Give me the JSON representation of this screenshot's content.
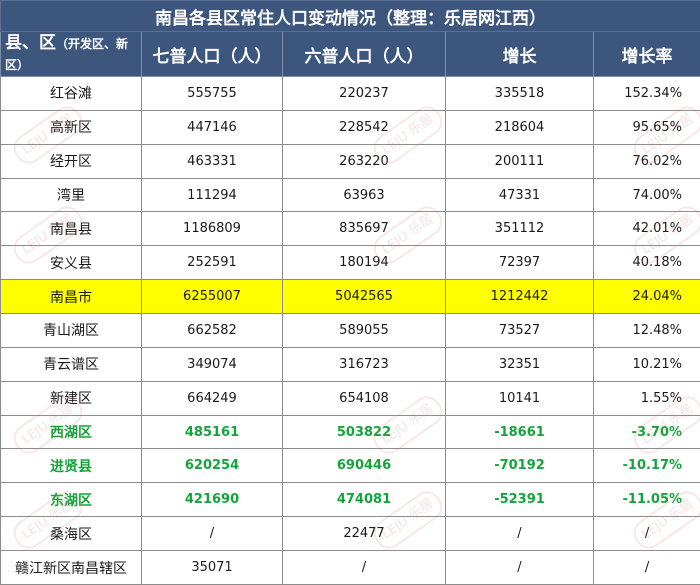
{
  "title": "南昌各县区常住人口变动情况（整理：乐居网江西）",
  "headers": {
    "district_main": "县、区",
    "district_note": "（开发区、新区）",
    "census7": "七普人口（人）",
    "census6": "六普人口（人）",
    "growth": "增长",
    "growth_rate": "增长率"
  },
  "watermark": "乐居",
  "colors": {
    "header_bg": "#3d567e",
    "highlight_bg": "#ffff00",
    "negative_text": "#15a43c"
  },
  "rows": [
    {
      "name": "红谷滩",
      "census7": "555755",
      "census6": "220237",
      "growth": "335518",
      "rate": "152.34%"
    },
    {
      "name": "高新区",
      "census7": "447146",
      "census6": "228542",
      "growth": "218604",
      "rate": "95.65%"
    },
    {
      "name": "经开区",
      "census7": "463331",
      "census6": "263220",
      "growth": "200111",
      "rate": "76.02%"
    },
    {
      "name": "湾里",
      "census7": "111294",
      "census6": "63963",
      "growth": "47331",
      "rate": "74.00%"
    },
    {
      "name": "南昌县",
      "census7": "1186809",
      "census6": "835697",
      "growth": "351112",
      "rate": "42.01%"
    },
    {
      "name": "安义县",
      "census7": "252591",
      "census6": "180194",
      "growth": "72397",
      "rate": "40.18%"
    },
    {
      "name": "南昌市",
      "census7": "6255007",
      "census6": "5042565",
      "growth": "1212442",
      "rate": "24.04%"
    },
    {
      "name": "青山湖区",
      "census7": "662582",
      "census6": "589055",
      "growth": "73527",
      "rate": "12.48%"
    },
    {
      "name": "青云谱区",
      "census7": "349074",
      "census6": "316723",
      "growth": "32351",
      "rate": "10.21%"
    },
    {
      "name": "新建区",
      "census7": "664249",
      "census6": "654108",
      "growth": "10141",
      "rate": "1.55%"
    },
    {
      "name": "西湖区",
      "census7": "485161",
      "census6": "503822",
      "growth": "-18661",
      "rate": "-3.70%"
    },
    {
      "name": "进贤县",
      "census7": "620254",
      "census6": "690446",
      "growth": "-70192",
      "rate": "-10.17%"
    },
    {
      "name": "东湖区",
      "census7": "421690",
      "census6": "474081",
      "growth": "-52391",
      "rate": "-11.05%"
    },
    {
      "name": "桑海区",
      "census7": "/",
      "census6": "22477",
      "growth": "/",
      "rate": "/"
    },
    {
      "name": "赣江新区南昌辖区",
      "census7": "35071",
      "census6": "/",
      "growth": "/",
      "rate": "/"
    }
  ]
}
